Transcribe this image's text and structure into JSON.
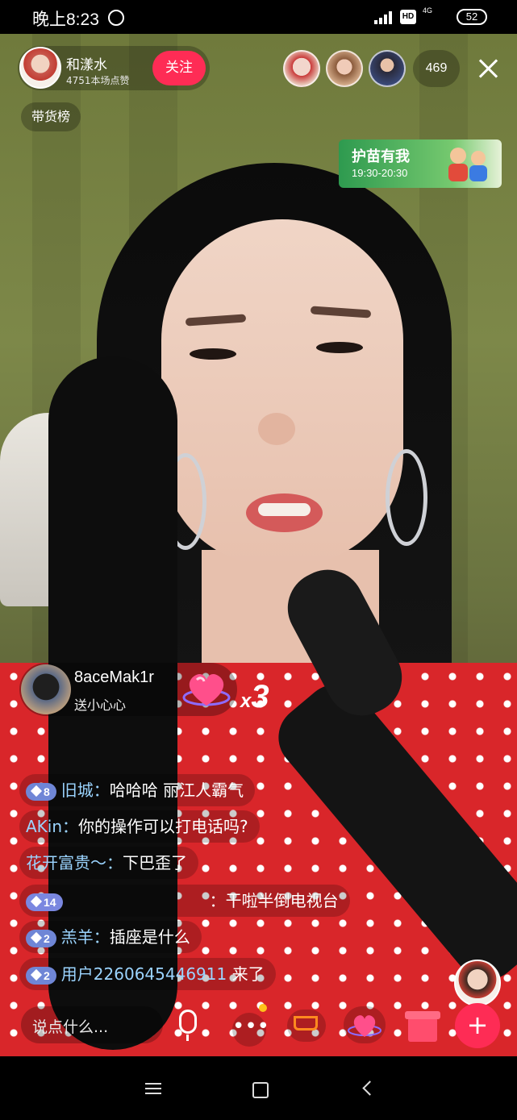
{
  "status_bar": {
    "time": "晚上8:23",
    "network": "4G",
    "battery": "52"
  },
  "host": {
    "name": "和漾水",
    "likes": "4751本场点赞",
    "follow_label": "关注"
  },
  "viewer_count": "469",
  "rank_label": "带货榜",
  "banner": {
    "title": "护苗有我",
    "time": "19:30-20:30"
  },
  "gift": {
    "user": "8aceMak1r",
    "action": "送小心心",
    "combo_prefix": "x",
    "combo_count": "3"
  },
  "comments": [
    {
      "level": "8",
      "name": "旧城：",
      "text": "哈哈哈  丽江人霸气"
    },
    {
      "level": "",
      "name": "AKin：",
      "text": "你的操作可以打电话吗?"
    },
    {
      "level": "",
      "name": "花开富贵～：",
      "text": "下巴歪了"
    },
    {
      "level": "14",
      "name": "",
      "text": "：干啦半倒电视台"
    },
    {
      "level": "2",
      "name": "羔羊：",
      "text": "插座是什么"
    },
    {
      "level": "2",
      "name": "用户2260645446911",
      "text": " 来了"
    }
  ],
  "input": {
    "placeholder": "说点什么..."
  },
  "colors": {
    "accent": "#fe2c55",
    "comment_name": "#9bd4ff",
    "level_badge": "#6f86d6"
  }
}
